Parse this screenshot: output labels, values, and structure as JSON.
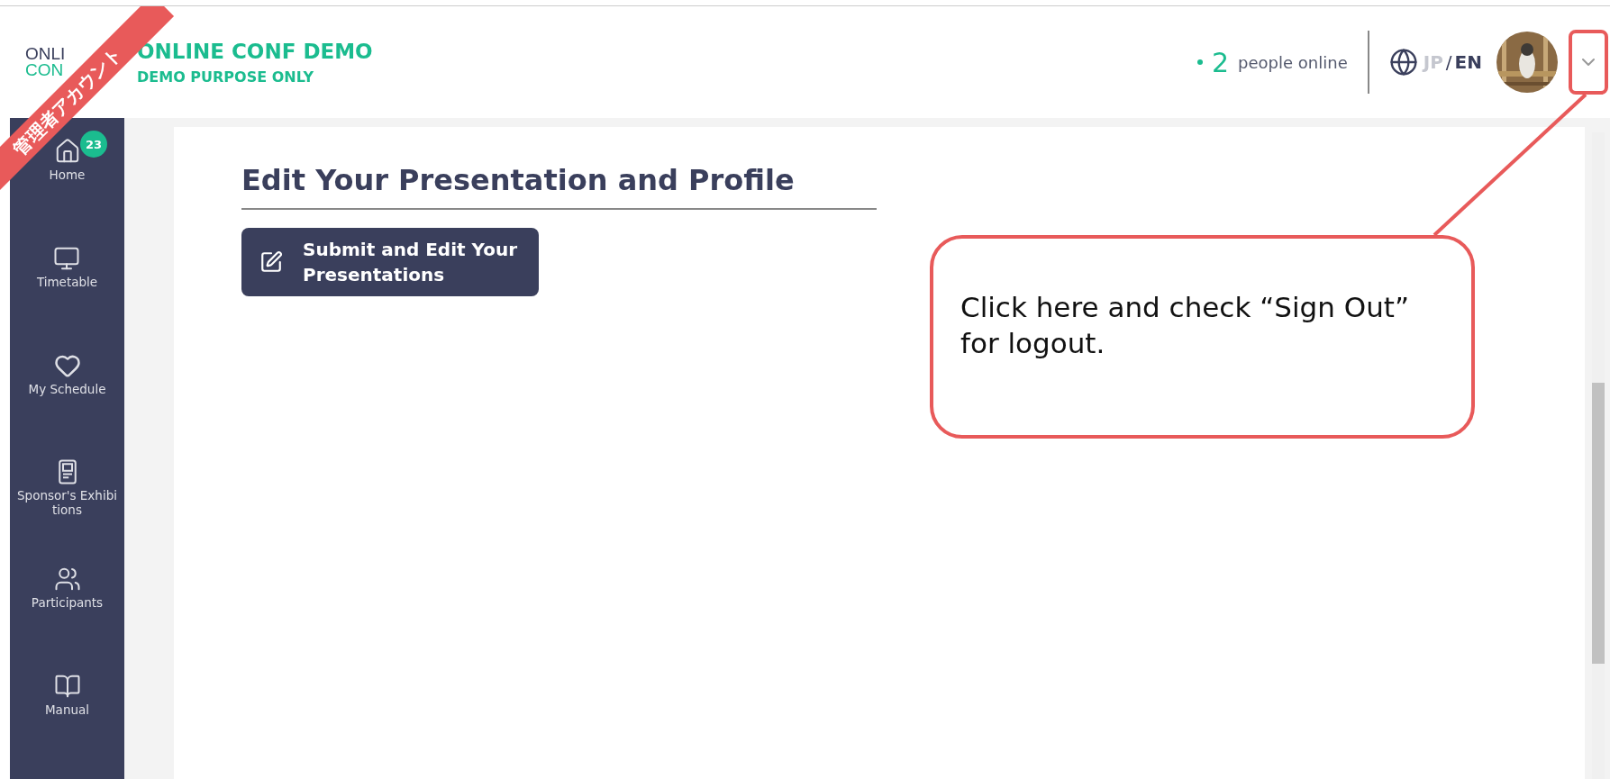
{
  "ribbon": {
    "label": "管理者アカウント"
  },
  "header": {
    "logo_lines": [
      "ONLI",
      "CON"
    ],
    "title": "ONLINE CONF DEMO",
    "subtitle": "DEMO PURPOSE ONLY",
    "online": {
      "count": "2",
      "label": "people online"
    },
    "language": {
      "separator": "/",
      "options": [
        {
          "label": "JP",
          "selected": false
        },
        {
          "label": "EN",
          "selected": true
        }
      ]
    }
  },
  "sidebar": {
    "items": [
      {
        "label": "Home",
        "badge": "23"
      },
      {
        "label": "Timetable"
      },
      {
        "label": "My Schedule"
      },
      {
        "label": "Sponsor's Exhibitions"
      },
      {
        "label": "Participants"
      },
      {
        "label": "Manual"
      }
    ]
  },
  "section": {
    "title": "Edit Your Presentation and Profile",
    "button": "Submit and Edit Your Presentations"
  },
  "callout": {
    "text": "Click here and check “Sign Out” for logout."
  }
}
